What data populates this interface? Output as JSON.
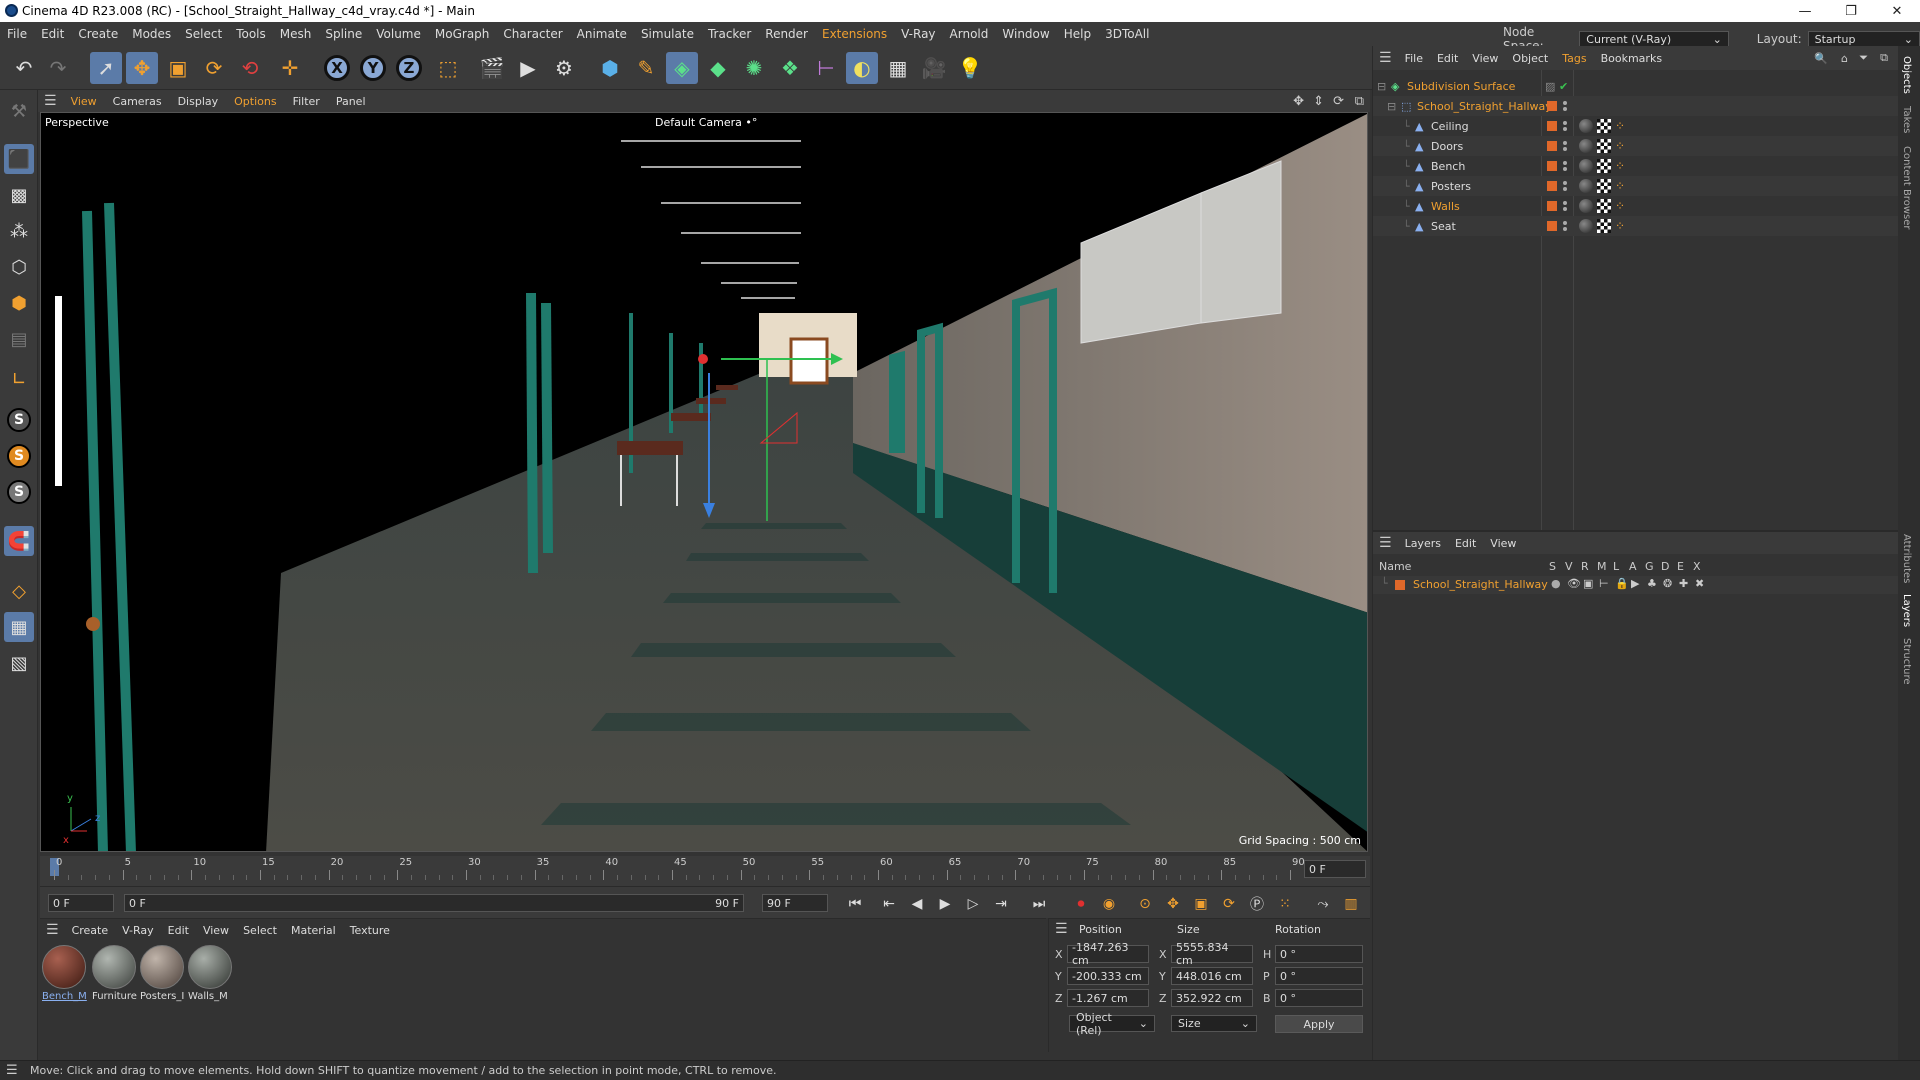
{
  "window": {
    "title": "Cinema 4D R23.008 (RC) - [School_Straight_Hallway_c4d_vray.c4d *] - Main",
    "minimize": "—",
    "restore": "❐",
    "close": "✕"
  },
  "menubar": {
    "items": [
      "File",
      "Edit",
      "Create",
      "Modes",
      "Select",
      "Tools",
      "Mesh",
      "Spline",
      "Volume",
      "MoGraph",
      "Character",
      "Animate",
      "Simulate",
      "Tracker",
      "Render",
      "Extensions",
      "V-Ray",
      "Arnold",
      "Window",
      "Help",
      "3DToAll"
    ],
    "node_space_label": "Node Space:",
    "node_space_value": "Current (V-Ray)",
    "layout_label": "Layout:",
    "layout_value": "Startup"
  },
  "toolbar": {
    "axis_x": "X",
    "axis_y": "Y",
    "axis_z": "Z"
  },
  "viewport_menu": {
    "items": [
      "View",
      "Cameras",
      "Display",
      "Options",
      "Filter",
      "Panel"
    ]
  },
  "viewport": {
    "label": "Perspective",
    "camera": "Default Camera",
    "camera_suffix": "•°",
    "grid_spacing": "Grid Spacing : 500 cm",
    "axis_y": "y",
    "axis_z": "z",
    "axis_x": "x"
  },
  "timeline": {
    "ticks": [
      "0",
      "5",
      "10",
      "15",
      "20",
      "25",
      "30",
      "35",
      "40",
      "45",
      "50",
      "55",
      "60",
      "65",
      "70",
      "75",
      "80",
      "85",
      "90"
    ],
    "current_frame_right": "0 F",
    "start_field": "0 F",
    "range_start": "0 F",
    "range_end": "90 F",
    "end_field": "90 F"
  },
  "material_panel": {
    "menu": [
      "Create",
      "V-Ray",
      "Edit",
      "View",
      "Select",
      "Material",
      "Texture"
    ],
    "materials": [
      {
        "name": "Bench_M",
        "color": "#5a2a1e"
      },
      {
        "name": "Furniture",
        "color": "#7a7f7a"
      },
      {
        "name": "Posters_I",
        "color": "#8a7f78"
      },
      {
        "name": "Walls_M",
        "color": "#6a6e6a"
      }
    ]
  },
  "attributes": {
    "position_hdr": "Position",
    "size_hdr": "Size",
    "rotation_hdr": "Rotation",
    "rows": [
      {
        "axis": "X",
        "pos": "-1847.263 cm",
        "size_axis": "X",
        "size": "5555.834 cm",
        "rot_axis": "H",
        "rot": "0 °"
      },
      {
        "axis": "Y",
        "pos": "-200.333 cm",
        "size_axis": "Y",
        "size": "448.016 cm",
        "rot_axis": "P",
        "rot": "0 °"
      },
      {
        "axis": "Z",
        "pos": "-1.267 cm",
        "size_axis": "Z",
        "size": "352.922 cm",
        "rot_axis": "B",
        "rot": "0 °"
      }
    ],
    "coord_mode": "Object (Rel)",
    "size_mode": "Size",
    "apply": "Apply"
  },
  "object_manager": {
    "menu": [
      "File",
      "Edit",
      "View",
      "Object",
      "Tags",
      "Bookmarks"
    ],
    "root": "Subdivision Surface",
    "group": "School_Straight_Hallway",
    "children": [
      "Ceiling",
      "Doors",
      "Bench",
      "Posters",
      "Walls",
      "Seat"
    ]
  },
  "layer_manager": {
    "menu": [
      "Layers",
      "Edit",
      "View"
    ],
    "name_col": "Name",
    "cols": [
      "S",
      "V",
      "R",
      "M",
      "L",
      "A",
      "G",
      "D",
      "E",
      "X"
    ],
    "layer": "School_Straight_Hallway"
  },
  "right_tabs": [
    "Objects",
    "Takes",
    "Content Browser",
    "Attributes",
    "Layers",
    "Structure"
  ],
  "statusbar": {
    "text": "Move: Click and drag to move elements. Hold down SHIFT to quantize movement / add to the selection in point mode, CTRL to remove."
  },
  "colors": {
    "accent": "#f0a030",
    "selection": "#5b7ba8",
    "layer_color": "#e0682a",
    "teal": "#1f6b60"
  }
}
